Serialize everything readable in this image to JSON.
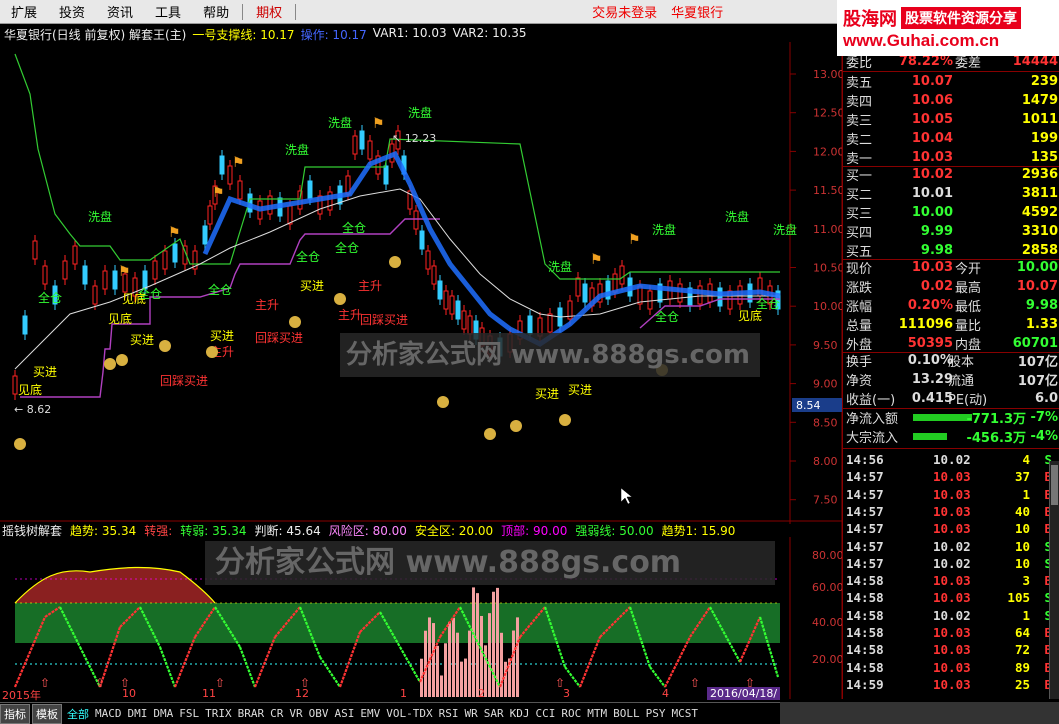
{
  "menu": {
    "items": [
      "扩展",
      "投资",
      "资讯",
      "工具",
      "帮助"
    ],
    "special": "期权",
    "login_status": "交易未登录",
    "bank": "华夏银行"
  },
  "logo": {
    "brand": "股海网",
    "tagline": "股票软件资源分享",
    "url": "www.Guhai.com.cn"
  },
  "chart": {
    "title": "华夏银行(日线 前复权) 解套王(主)",
    "ind1_label": "一号支撑线: 10.17",
    "ind2_label": "操作: 10.17",
    "var1": "VAR1: 10.03",
    "var2": "VAR2: 10.35",
    "price_axis": [
      "13.00",
      "12.50",
      "12.00",
      "11.50",
      "11.00",
      "10.50",
      "10.00",
      "9.50",
      "9.00",
      "8.50",
      "8.00",
      "7.50"
    ],
    "current_price_tag": "8.54",
    "high_marker": "12.23",
    "low_marker": "8.62",
    "annotations": [
      "洗盘",
      "洗盘",
      "洗盘",
      "洗盘",
      "洗盘",
      "洗盘",
      "洗盘",
      "洗盘",
      "全仓",
      "全仓",
      "全仓",
      "全仓",
      "全仓",
      "全仓",
      "全仓",
      "全仓",
      "主升",
      "主升",
      "主升",
      "主升",
      "买进",
      "买进",
      "买进",
      "买进",
      "买进",
      "买进",
      "见底",
      "见底",
      "见底",
      "见底",
      "回踩买进",
      "回踩买进",
      "回踩买进"
    ],
    "watermark": "分析家公式网 www.888gs.com"
  },
  "sub": {
    "title": "摇钱树解套",
    "trend": "趋势: 35.34",
    "strong": "转强:",
    "weak": "转弱: 35.34",
    "judge": "判断: 45.64",
    "risk": "风险区: 80.00",
    "safe": "安全区: 20.00",
    "top": "顶部: 90.00",
    "strongweak": "强弱线: 50.00",
    "trend1": "趋势1: 15.90",
    "axis": [
      "80.00",
      "60.00",
      "40.00",
      "20.00"
    ],
    "watermark": "分析家公式网 www.888gs.com"
  },
  "dates": [
    "2015年",
    "10",
    "11",
    "12",
    "1",
    "2",
    "3",
    "4",
    "2016/04/18/"
  ],
  "tabs": [
    "指标",
    "模板",
    "全部",
    "MACD",
    "DMI",
    "DMA",
    "FSL",
    "TRIX",
    "BRAR",
    "CR",
    "VR",
    "OBV",
    "ASI",
    "EMV",
    "VOL-TDX",
    "RSI",
    "WR",
    "SAR",
    "KDJ",
    "CCI",
    "ROC",
    "MTM",
    "BOLL",
    "PSY",
    "MCST"
  ],
  "quote": {
    "weibi": {
      "label": "委比",
      "value": "78.22%",
      "label2": "委差",
      "value2": "14444"
    },
    "asks": [
      {
        "label": "卖五",
        "price": "10.07",
        "vol": "239"
      },
      {
        "label": "卖四",
        "price": "10.06",
        "vol": "1479"
      },
      {
        "label": "卖三",
        "price": "10.05",
        "vol": "1011"
      },
      {
        "label": "卖二",
        "price": "10.04",
        "vol": "199"
      },
      {
        "label": "卖一",
        "price": "10.03",
        "vol": "135"
      }
    ],
    "bids": [
      {
        "label": "买一",
        "price": "10.02",
        "vol": "2936"
      },
      {
        "label": "买二",
        "price": "10.01",
        "vol": "3811"
      },
      {
        "label": "买三",
        "price": "10.00",
        "vol": "4592"
      },
      {
        "label": "买四",
        "price": "9.99",
        "vol": "3310"
      },
      {
        "label": "买五",
        "price": "9.98",
        "vol": "2858"
      }
    ],
    "stats": [
      {
        "l1": "现价",
        "v1": "10.03",
        "c1": "#f33",
        "l2": "今开",
        "v2": "10.00",
        "c2": "#3f3"
      },
      {
        "l1": "涨跌",
        "v1": "0.02",
        "c1": "#f33",
        "l2": "最高",
        "v2": "10.07",
        "c2": "#f33"
      },
      {
        "l1": "涨幅",
        "v1": "0.20%",
        "c1": "#f33",
        "l2": "最低",
        "v2": "9.98",
        "c2": "#3f3"
      },
      {
        "l1": "总量",
        "v1": "111096",
        "c1": "#ff0",
        "l2": "量比",
        "v2": "1.33",
        "c2": "#ff0"
      },
      {
        "l1": "外盘",
        "v1": "50395",
        "c1": "#f33",
        "l2": "内盘",
        "v2": "60701",
        "c2": "#3f3"
      }
    ],
    "stats2": [
      {
        "l1": "换手",
        "v1": "0.10%",
        "l2": "股本",
        "v2": "107亿"
      },
      {
        "l1": "净资",
        "v1": "13.29",
        "l2": "流通",
        "v2": "107亿"
      },
      {
        "l1": "收益(一)",
        "v1": "0.415",
        "l2": "PE(动)",
        "v2": "6.0"
      }
    ],
    "flows": [
      {
        "label": "净流入额",
        "value": "-771.3万",
        "pct": "-7%",
        "frac": 0.7
      },
      {
        "label": "大宗流入",
        "value": "-456.3万",
        "pct": "-4%",
        "frac": 0.4
      }
    ]
  },
  "ticks": [
    {
      "t": "14:56",
      "p": "10.02",
      "v": "4",
      "d": "S"
    },
    {
      "t": "14:57",
      "p": "10.03",
      "v": "37",
      "d": "B"
    },
    {
      "t": "14:57",
      "p": "10.03",
      "v": "1",
      "d": "B"
    },
    {
      "t": "14:57",
      "p": "10.03",
      "v": "40",
      "d": "B"
    },
    {
      "t": "14:57",
      "p": "10.03",
      "v": "10",
      "d": "B"
    },
    {
      "t": "14:57",
      "p": "10.02",
      "v": "10",
      "d": "S"
    },
    {
      "t": "14:57",
      "p": "10.02",
      "v": "10",
      "d": "S"
    },
    {
      "t": "14:58",
      "p": "10.03",
      "v": "3",
      "d": "B"
    },
    {
      "t": "14:58",
      "p": "10.03",
      "v": "105",
      "d": "S"
    },
    {
      "t": "14:58",
      "p": "10.02",
      "v": "1",
      "d": "S"
    },
    {
      "t": "14:58",
      "p": "10.03",
      "v": "64",
      "d": "B"
    },
    {
      "t": "14:58",
      "p": "10.03",
      "v": "72",
      "d": "B"
    },
    {
      "t": "14:58",
      "p": "10.03",
      "v": "89",
      "d": "B"
    },
    {
      "t": "14:59",
      "p": "10.03",
      "v": "25",
      "d": "B"
    }
  ]
}
